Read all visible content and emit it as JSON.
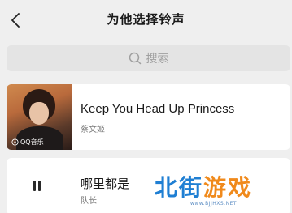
{
  "header": {
    "title": "为他选择铃声"
  },
  "search": {
    "placeholder": "搜索"
  },
  "songs": [
    {
      "title": "Keep You Head Up Princess",
      "artist": "蔡文姬",
      "cover_badge": "QQ音乐"
    },
    {
      "title": "哪里都是",
      "artist": "队长",
      "state": "playing"
    }
  ],
  "watermark": {
    "text_part1": "北街",
    "text_part2": "游戏",
    "url": "www.BJJHXS.NET"
  },
  "colors": {
    "background": "#efefef",
    "search_bg": "#e4e4e4",
    "watermark_blue": "#1f7fd3",
    "watermark_orange": "#f08a1c"
  }
}
